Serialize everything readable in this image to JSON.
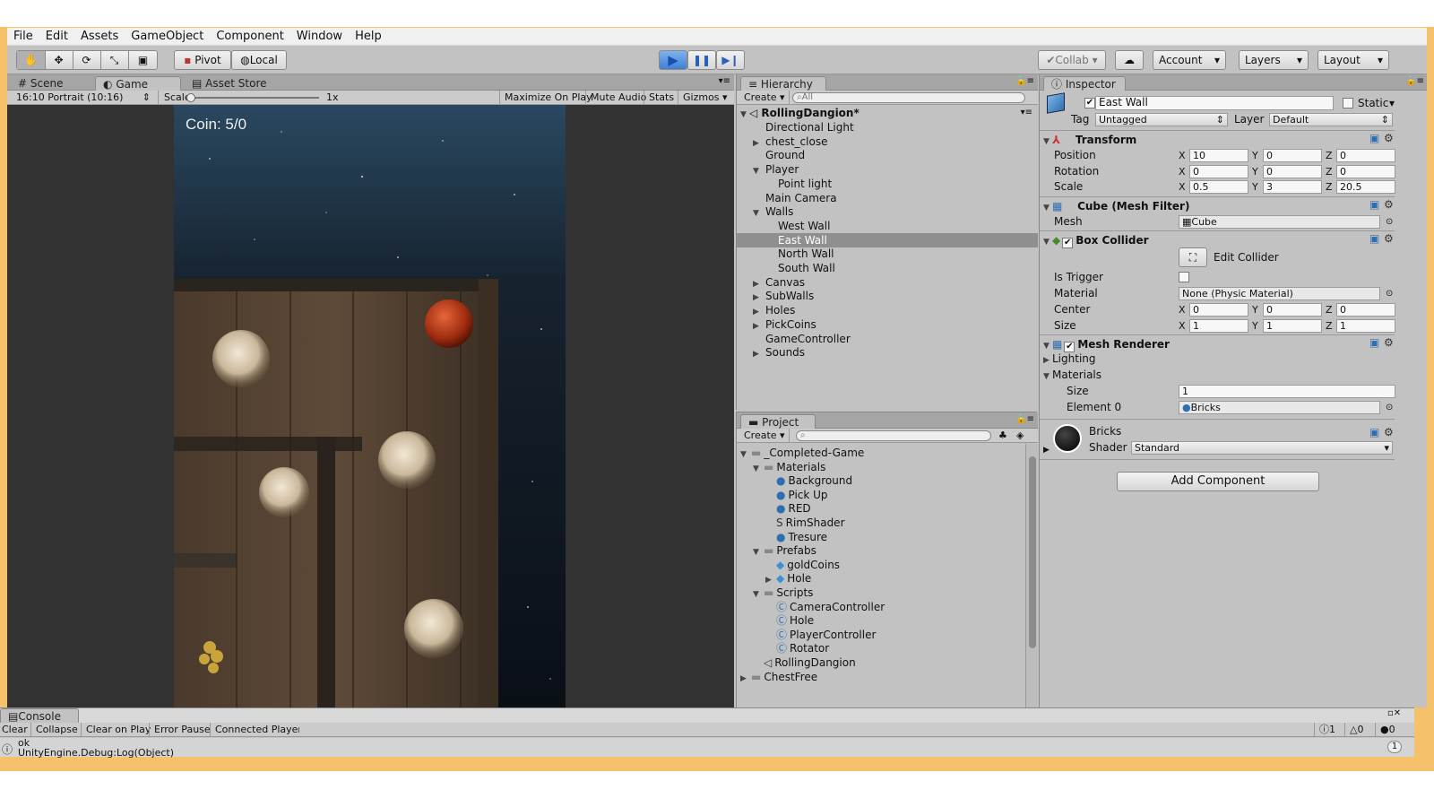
{
  "menu": [
    "File",
    "Edit",
    "Assets",
    "GameObject",
    "Component",
    "Window",
    "Help"
  ],
  "toolbar": {
    "pivot": "Pivot",
    "local": "Local",
    "collab": "Collab",
    "account": "Account",
    "layers": "Layers",
    "layout": "Layout"
  },
  "game_view": {
    "tabs": [
      "Scene",
      "Game",
      "Asset Store"
    ],
    "aspect": "16:10 Portrait (10:16)",
    "scale_label": "Scale",
    "scale_value": "1x",
    "buttons": [
      "Maximize On Play",
      "Mute Audio",
      "Stats",
      "Gizmos"
    ],
    "coin_text": "Coin: 5/0"
  },
  "hierarchy": {
    "tab": "Hierarchy",
    "create": "Create",
    "search_placeholder": "All",
    "scene": "RollingDangion*",
    "items": [
      {
        "label": "Directional Light",
        "depth": 1,
        "arrow": ""
      },
      {
        "label": "chest_close",
        "depth": 1,
        "arrow": "▶"
      },
      {
        "label": "Ground",
        "depth": 1,
        "arrow": ""
      },
      {
        "label": "Player",
        "depth": 1,
        "arrow": "▼"
      },
      {
        "label": "Point light",
        "depth": 2,
        "arrow": ""
      },
      {
        "label": "Main Camera",
        "depth": 1,
        "arrow": ""
      },
      {
        "label": "Walls",
        "depth": 1,
        "arrow": "▼"
      },
      {
        "label": "West Wall",
        "depth": 2,
        "arrow": ""
      },
      {
        "label": "East Wall",
        "depth": 2,
        "arrow": "",
        "selected": true
      },
      {
        "label": "North Wall",
        "depth": 2,
        "arrow": ""
      },
      {
        "label": "South Wall",
        "depth": 2,
        "arrow": ""
      },
      {
        "label": "Canvas",
        "depth": 1,
        "arrow": "▶"
      },
      {
        "label": "SubWalls",
        "depth": 1,
        "arrow": "▶"
      },
      {
        "label": "Holes",
        "depth": 1,
        "arrow": "▶"
      },
      {
        "label": "PickCoins",
        "depth": 1,
        "arrow": "▶"
      },
      {
        "label": "GameController",
        "depth": 1,
        "arrow": ""
      },
      {
        "label": "Sounds",
        "depth": 1,
        "arrow": "▶"
      }
    ]
  },
  "project": {
    "tab": "Project",
    "create": "Create",
    "items": [
      {
        "label": "_Completed-Game",
        "depth": 0,
        "arrow": "▼",
        "icon": "folder"
      },
      {
        "label": "Materials",
        "depth": 1,
        "arrow": "▼",
        "icon": "folder"
      },
      {
        "label": "Background",
        "depth": 2,
        "arrow": "",
        "icon": "material"
      },
      {
        "label": "Pick Up",
        "depth": 2,
        "arrow": "",
        "icon": "material"
      },
      {
        "label": "RED",
        "depth": 2,
        "arrow": "",
        "icon": "material"
      },
      {
        "label": "RimShader",
        "depth": 2,
        "arrow": "",
        "icon": "shader"
      },
      {
        "label": "Tresure",
        "depth": 2,
        "arrow": "",
        "icon": "material"
      },
      {
        "label": "Prefabs",
        "depth": 1,
        "arrow": "▼",
        "icon": "folder"
      },
      {
        "label": "goldCoins",
        "depth": 2,
        "arrow": "",
        "icon": "prefab"
      },
      {
        "label": "Hole",
        "depth": 2,
        "arrow": "▶",
        "icon": "prefab"
      },
      {
        "label": "Scripts",
        "depth": 1,
        "arrow": "▼",
        "icon": "folder"
      },
      {
        "label": "CameraController",
        "depth": 2,
        "arrow": "",
        "icon": "script"
      },
      {
        "label": "Hole",
        "depth": 2,
        "arrow": "",
        "icon": "script"
      },
      {
        "label": "PlayerController",
        "depth": 2,
        "arrow": "",
        "icon": "script"
      },
      {
        "label": "Rotator",
        "depth": 2,
        "arrow": "",
        "icon": "script"
      },
      {
        "label": "RollingDangion",
        "depth": 1,
        "arrow": "",
        "icon": "scene"
      },
      {
        "label": "ChestFree",
        "depth": 0,
        "arrow": "▶",
        "icon": "folder"
      }
    ]
  },
  "inspector": {
    "tab": "Inspector",
    "object_name": "East Wall",
    "static_label": "Static",
    "tag_label": "Tag",
    "tag_value": "Untagged",
    "layer_label": "Layer",
    "layer_value": "Default",
    "transform": {
      "title": "Transform",
      "rows": [
        {
          "label": "Position",
          "x": "10",
          "y": "0",
          "z": "0"
        },
        {
          "label": "Rotation",
          "x": "0",
          "y": "0",
          "z": "0"
        },
        {
          "label": "Scale",
          "x": "0.5",
          "y": "3",
          "z": "20.5"
        }
      ]
    },
    "mesh_filter": {
      "title": "Cube (Mesh Filter)",
      "mesh_label": "Mesh",
      "mesh_value": "Cube"
    },
    "box_collider": {
      "title": "Box Collider",
      "edit_label": "Edit Collider",
      "is_trigger_label": "Is Trigger",
      "material_label": "Material",
      "material_value": "None (Physic Material)",
      "center_label": "Center",
      "center": {
        "x": "0",
        "y": "0",
        "z": "0"
      },
      "size_label": "Size",
      "size": {
        "x": "1",
        "y": "1",
        "z": "1"
      }
    },
    "mesh_renderer": {
      "title": "Mesh Renderer",
      "lighting": "Lighting",
      "materials": "Materials",
      "size_label": "Size",
      "size_value": "1",
      "element_label": "Element 0",
      "element_value": "Bricks"
    },
    "material": {
      "name": "Bricks",
      "shader_label": "Shader",
      "shader_value": "Standard"
    },
    "add_component": "Add Component"
  },
  "console": {
    "tab": "Console",
    "buttons": [
      "Clear",
      "Collapse",
      "Clear on Play",
      "Error Pause",
      "Connected Player"
    ],
    "counts": {
      "log": "1",
      "warn": "0",
      "error": "0"
    },
    "message_line1": "ok",
    "message_line2": "UnityEngine.Debug:Log(Object)",
    "message_count": "1"
  },
  "colors": {
    "accent_play": "#3f7fd4",
    "selection": "#8f8f8f",
    "frame": "#f5c26b"
  }
}
